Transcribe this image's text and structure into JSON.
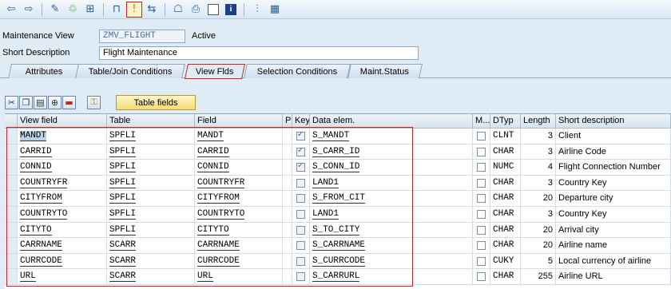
{
  "toolbar": {
    "icons": [
      "back-arrow-icon",
      "forward-arrow-icon",
      "edit-icon",
      "display-change-icon",
      "check-icon",
      "hierarchy-icon",
      "info-cursor-icon",
      "move-icon",
      "tree-icon",
      "print-icon",
      "box-icon",
      "info-icon",
      "layout-icon",
      "table-icon"
    ]
  },
  "form": {
    "maintenance_view_label": "Maintenance View",
    "maintenance_view_value": "ZMV_FLIGHT",
    "status": "Active",
    "short_description_label": "Short Description",
    "short_description_value": "Flight Maintenance"
  },
  "tabs": [
    "Attributes",
    "Table/Join Conditions",
    "View Flds",
    "Selection Conditions",
    "Maint.Status"
  ],
  "table_fields_button": "Table fields",
  "columns": {
    "view_field": "View field",
    "table": "Table",
    "field": "Field",
    "p": "P",
    "key": "Key",
    "data_elem": "Data elem.",
    "m": "M...",
    "dtyp": "DTyp",
    "length": "Length",
    "short_desc": "Short description"
  },
  "rows": [
    {
      "view_field": "MANDT",
      "table": "SPFLI",
      "field": "MANDT",
      "key": true,
      "data_elem": "S_MANDT",
      "dtyp": "CLNT",
      "length": "3",
      "desc": "Client"
    },
    {
      "view_field": "CARRID",
      "table": "SPFLI",
      "field": "CARRID",
      "key": true,
      "data_elem": "S_CARR_ID",
      "dtyp": "CHAR",
      "length": "3",
      "desc": "Airline Code"
    },
    {
      "view_field": "CONNID",
      "table": "SPFLI",
      "field": "CONNID",
      "key": true,
      "data_elem": "S_CONN_ID",
      "dtyp": "NUMC",
      "length": "4",
      "desc": "Flight Connection Number"
    },
    {
      "view_field": "COUNTRYFR",
      "table": "SPFLI",
      "field": "COUNTRYFR",
      "key": false,
      "data_elem": "LAND1",
      "dtyp": "CHAR",
      "length": "3",
      "desc": "Country Key"
    },
    {
      "view_field": "CITYFROM",
      "table": "SPFLI",
      "field": "CITYFROM",
      "key": false,
      "data_elem": "S_FROM_CIT",
      "dtyp": "CHAR",
      "length": "20",
      "desc": "Departure city"
    },
    {
      "view_field": "COUNTRYTO",
      "table": "SPFLI",
      "field": "COUNTRYTO",
      "key": false,
      "data_elem": "LAND1",
      "dtyp": "CHAR",
      "length": "3",
      "desc": "Country Key"
    },
    {
      "view_field": "CITYTO",
      "table": "SPFLI",
      "field": "CITYTO",
      "key": false,
      "data_elem": "S_TO_CITY",
      "dtyp": "CHAR",
      "length": "20",
      "desc": "Arrival city"
    },
    {
      "view_field": "CARRNAME",
      "table": "SCARR",
      "field": "CARRNAME",
      "key": false,
      "data_elem": "S_CARRNAME",
      "dtyp": "CHAR",
      "length": "20",
      "desc": "Airline name"
    },
    {
      "view_field": "CURRCODE",
      "table": "SCARR",
      "field": "CURRCODE",
      "key": false,
      "data_elem": "S_CURRCODE",
      "dtyp": "CUKY",
      "length": "5",
      "desc": "Local currency of airline"
    },
    {
      "view_field": "URL",
      "table": "SCARR",
      "field": "URL",
      "key": false,
      "data_elem": "S_CARRURL",
      "dtyp": "CHAR",
      "length": "255",
      "desc": "Airline URL"
    }
  ]
}
